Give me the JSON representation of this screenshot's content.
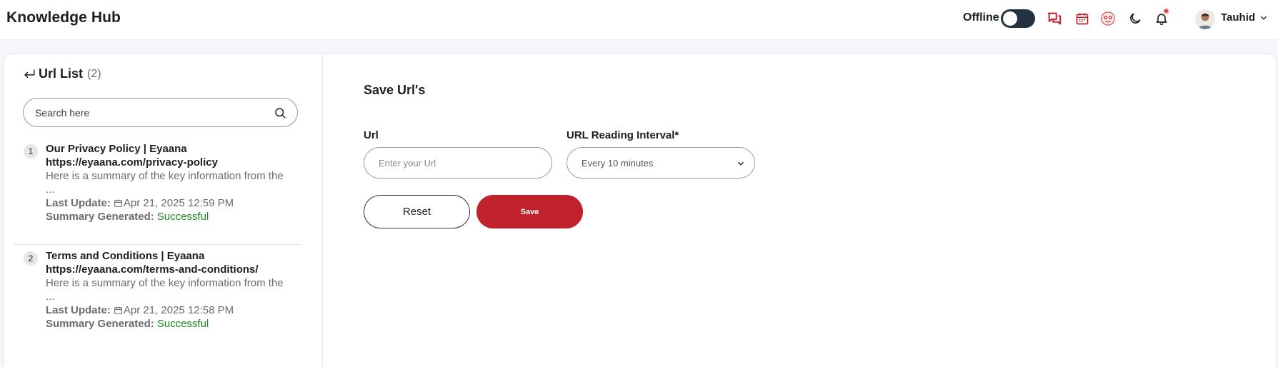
{
  "header": {
    "app_title": "Knowledge Hub",
    "offline_label": "Offline",
    "user_name": "Tauhid",
    "accent_color": "#bf222b",
    "icons": [
      "chat-icon",
      "calendar-icon",
      "bot-avatar-icon",
      "moon-icon",
      "bell-icon",
      "user-avatar",
      "chevron-down-icon"
    ]
  },
  "sidebar": {
    "title": "Url List",
    "count": "(2)",
    "search_placeholder": "Search here",
    "items": [
      {
        "number": "1",
        "title": "Our Privacy Policy | Eyaana",
        "url": "https://eyaana.com/privacy-policy",
        "summary": "Here is a summary of the key information from the ...",
        "last_update_label": "Last Update:",
        "last_update": "Apr 21, 2025 12:59 PM",
        "summary_label": "Summary Generated:",
        "summary_status": "Successful"
      },
      {
        "number": "2",
        "title": "Terms and Conditions | Eyaana",
        "url": "https://eyaana.com/terms-and-conditions/",
        "summary": "Here is a summary of the key information from the ...",
        "last_update_label": "Last Update:",
        "last_update": "Apr 21, 2025 12:58 PM",
        "summary_label": "Summary Generated:",
        "summary_status": "Successful"
      }
    ]
  },
  "form": {
    "title": "Save Url's",
    "url_label": "Url",
    "url_placeholder": "Enter your Url",
    "interval_label": "URL Reading Interval*",
    "interval_value": "Every 10 minutes",
    "reset_label": "Reset",
    "save_label": "Save"
  }
}
